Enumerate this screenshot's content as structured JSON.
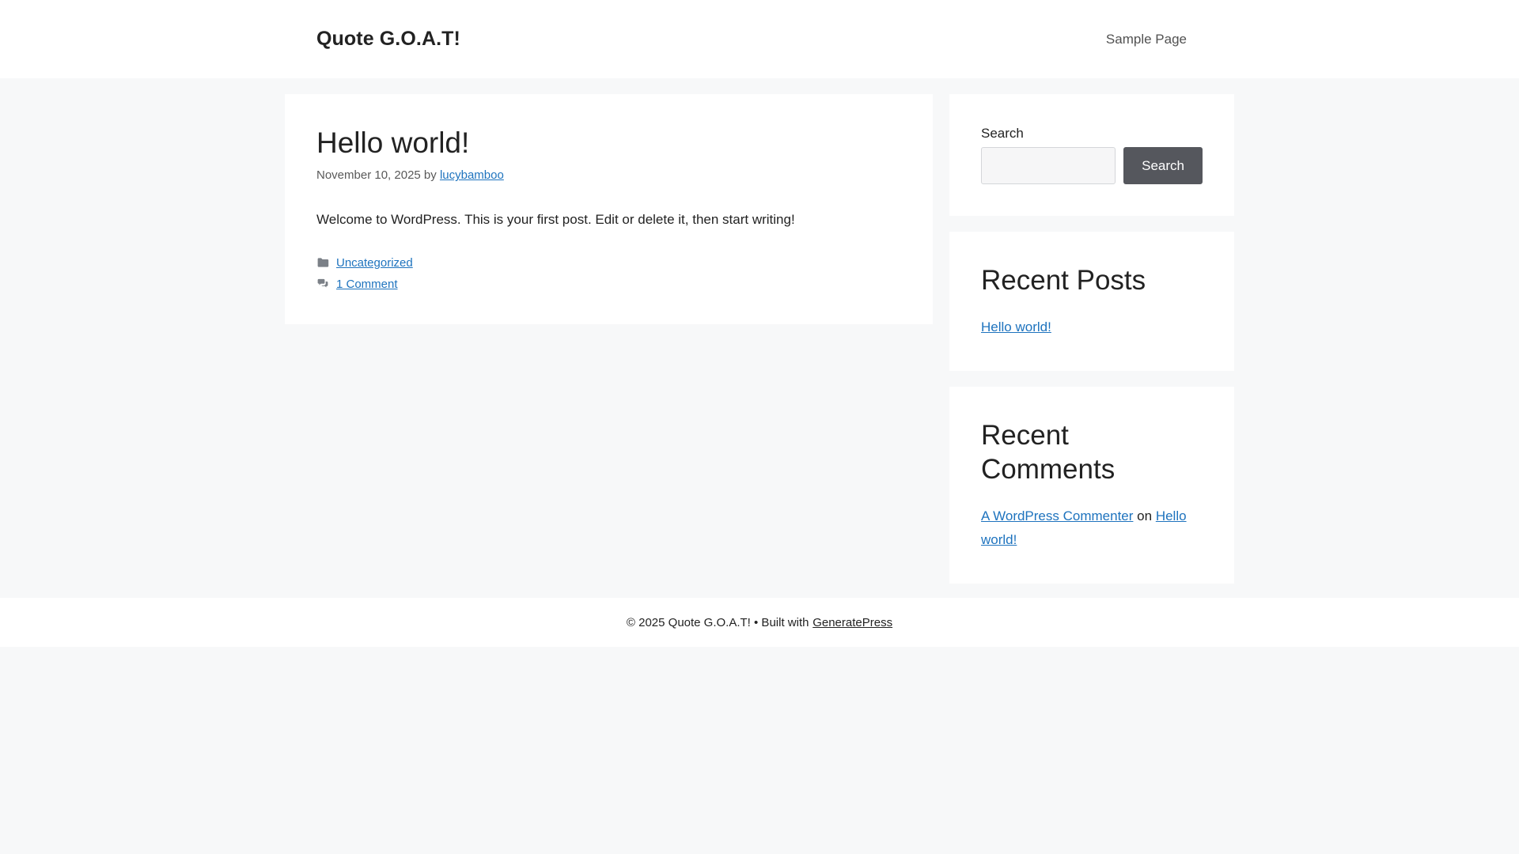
{
  "site": {
    "title": "Quote G.O.A.T!"
  },
  "nav": {
    "items": [
      {
        "label": "Sample Page"
      }
    ]
  },
  "post": {
    "title": "Hello world!",
    "date": "November 10, 2025",
    "by_label": "by",
    "author": "lucybamboo",
    "body": "Welcome to WordPress. This is your first post. Edit or delete it, then start writing!",
    "category": "Uncategorized",
    "comments_label": "1 Comment"
  },
  "sidebar": {
    "search": {
      "label": "Search",
      "button_label": "Search",
      "input_value": ""
    },
    "recent_posts": {
      "title": "Recent Posts",
      "items": [
        {
          "label": "Hello world!"
        }
      ]
    },
    "recent_comments": {
      "title": "Recent Comments",
      "items": [
        {
          "author": "A WordPress Commenter",
          "connector": "on",
          "post": "Hello world!"
        }
      ]
    }
  },
  "footer": {
    "copyright_prefix": "© 2025 Quote G.O.A.T! • Built with",
    "builder_link": "GeneratePress"
  },
  "colors": {
    "link": "#1e73be",
    "text": "#222222",
    "meta": "#595959",
    "page_bg": "#f7f8f9",
    "button_bg": "#55575d",
    "card_bg": "#ffffff"
  },
  "icons": [
    "folder-icon",
    "comments-icon"
  ]
}
